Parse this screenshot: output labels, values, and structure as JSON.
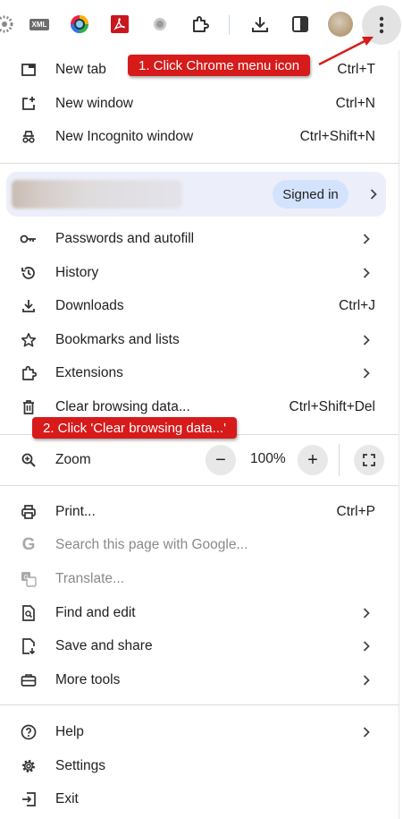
{
  "toolbar": {
    "xml_label": "XML",
    "icons": [
      "extension-puzzle-icon",
      "download-icon",
      "side-panel-icon",
      "avatar",
      "kebab-menu-icon"
    ]
  },
  "menu": {
    "new_tab": {
      "label": "New tab",
      "shortcut": "Ctrl+T"
    },
    "new_window": {
      "label": "New window",
      "shortcut": "Ctrl+N"
    },
    "new_incognito": {
      "label": "New Incognito window",
      "shortcut": "Ctrl+Shift+N"
    },
    "profile": {
      "signed_in": "Signed in"
    },
    "passwords": {
      "label": "Passwords and autofill"
    },
    "history": {
      "label": "History"
    },
    "downloads": {
      "label": "Downloads",
      "shortcut": "Ctrl+J"
    },
    "bookmarks": {
      "label": "Bookmarks and lists"
    },
    "extensions": {
      "label": "Extensions"
    },
    "clear": {
      "label": "Clear browsing data...",
      "shortcut": "Ctrl+Shift+Del"
    },
    "zoom": {
      "label": "Zoom",
      "value": "100%",
      "minus": "−",
      "plus": "+"
    },
    "print": {
      "label": "Print...",
      "shortcut": "Ctrl+P"
    },
    "search_google": {
      "label": "Search this page with Google..."
    },
    "translate": {
      "label": "Translate..."
    },
    "find_edit": {
      "label": "Find and edit"
    },
    "save_share": {
      "label": "Save and share"
    },
    "more_tools": {
      "label": "More tools"
    },
    "help": {
      "label": "Help"
    },
    "settings": {
      "label": "Settings"
    },
    "exit": {
      "label": "Exit"
    }
  },
  "annotations": {
    "step1": "1. Click Chrome menu icon",
    "step2": "2. Click 'Clear browsing data...'"
  },
  "colors": {
    "annotation": "#d71a1a",
    "signed_in_pill": "#d3e3fd",
    "profile_card": "#eceff9"
  }
}
